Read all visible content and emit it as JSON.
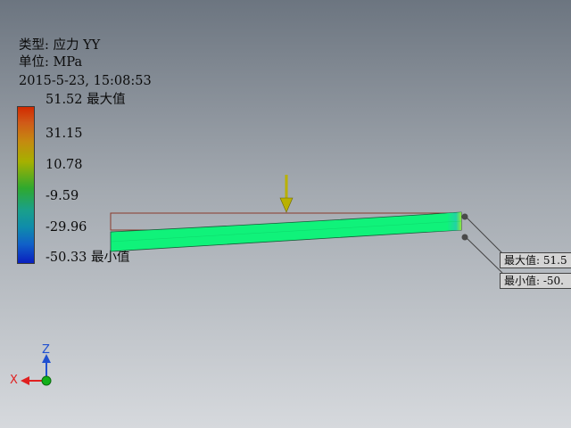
{
  "info": {
    "type_label": "类型: 应力 YY",
    "unit_label": "单位: MPa",
    "timestamp": "2015-5-23, 15:08:53"
  },
  "legend": {
    "labels": [
      "51.52 最大值",
      "31.15",
      "10.78",
      "-9.59",
      "-29.96",
      "-50.33 最小值"
    ],
    "max_color": "#d22a00",
    "min_color": "#0a1fbf"
  },
  "callouts": {
    "max_text": "最大值: 51.5",
    "min_text": "最小值: -50."
  },
  "axes": {
    "z_label": "Z",
    "x_label": "X"
  },
  "colors": {
    "beam_fill": "#10f27a",
    "load_arrow": "#b9b100",
    "undeformed_outline": "#8a3a2a"
  }
}
